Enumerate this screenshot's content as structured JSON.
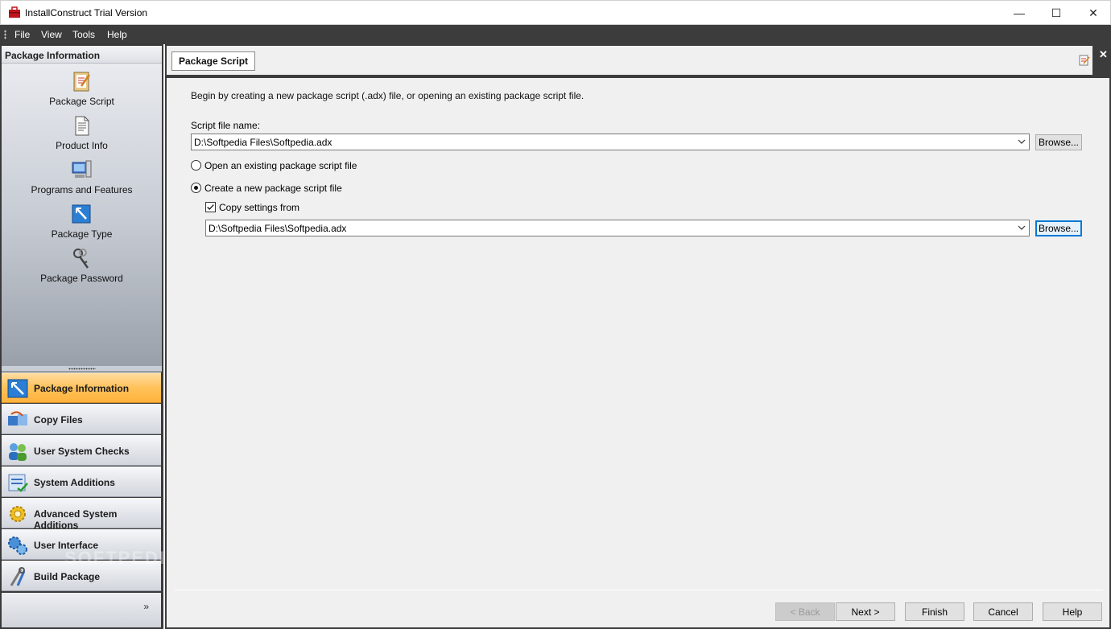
{
  "window": {
    "title": "InstallConstruct Trial Version",
    "minimize_glyph": "—",
    "maximize_glyph": "☐",
    "close_glyph": "✕"
  },
  "menu": {
    "items": [
      "File",
      "View",
      "Tools",
      "Help"
    ]
  },
  "left_pane": {
    "header": "Package Information",
    "items": [
      {
        "label": "Package Script",
        "icon": "clipboard-pencil-icon"
      },
      {
        "label": "Product Info",
        "icon": "document-icon"
      },
      {
        "label": "Programs and Features",
        "icon": "computer-icon"
      },
      {
        "label": "Package Type",
        "icon": "package-type-icon"
      },
      {
        "label": "Package Password",
        "icon": "keys-icon"
      }
    ]
  },
  "nav": {
    "buttons": [
      {
        "label": "Package Information",
        "icon": "package-info-icon",
        "active": true
      },
      {
        "label": "Copy Files",
        "icon": "copy-files-icon",
        "active": false
      },
      {
        "label": "User System Checks",
        "icon": "users-icon",
        "active": false
      },
      {
        "label": "System Additions",
        "icon": "checklist-icon",
        "active": false
      },
      {
        "label": "Advanced System Additions",
        "icon": "gear-icon",
        "active": false
      },
      {
        "label": "User Interface",
        "icon": "gears-icon",
        "active": false
      },
      {
        "label": "Build Package",
        "icon": "tools-icon",
        "active": false
      }
    ],
    "more_glyph": "»"
  },
  "tab": {
    "label": "Package Script",
    "close_glyph": "✕"
  },
  "form": {
    "intro": "Begin by creating a new package script (.adx) file, or opening an existing package script file.",
    "script_label": "Script file name:",
    "script_value": "D:\\Softpedia Files\\Softpedia.adx",
    "browse_label": "Browse...",
    "radio_open": "Open an existing package script file",
    "radio_create": "Create a new package script file",
    "copy_settings_label": "Copy settings from",
    "copy_settings_value": "D:\\Softpedia Files\\Softpedia.adx",
    "browse2_label": "Browse...",
    "selected_radio": "create",
    "copy_checked": true
  },
  "wizard": {
    "back": "< Back",
    "next": "Next >",
    "finish": "Finish",
    "cancel": "Cancel",
    "help": "Help"
  },
  "watermark": "SOFTPEDIA"
}
